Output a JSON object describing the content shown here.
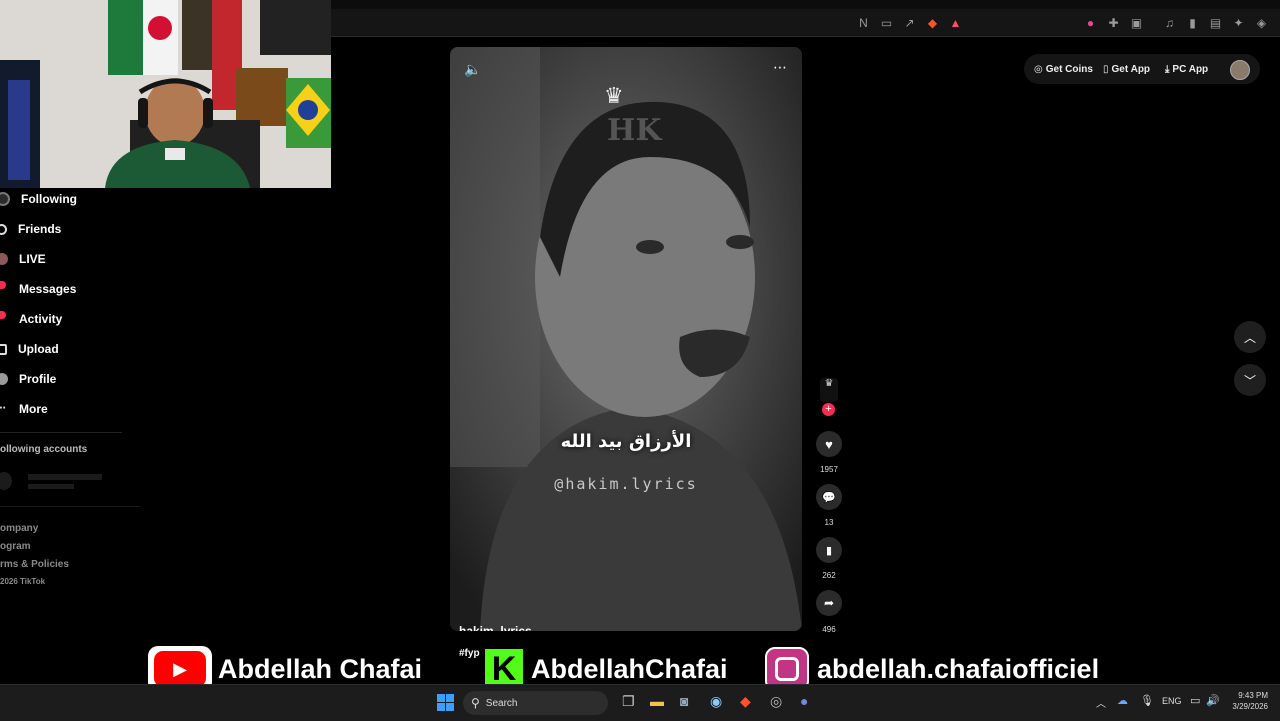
{
  "sidebar": {
    "items": [
      {
        "label": "Following",
        "icon": "following-icon"
      },
      {
        "label": "Friends",
        "icon": "friends-icon"
      },
      {
        "label": "LIVE",
        "icon": "live-icon"
      },
      {
        "label": "Messages",
        "icon": "messages-icon"
      },
      {
        "label": "Activity",
        "icon": "activity-icon"
      },
      {
        "label": "Upload",
        "icon": "upload-icon"
      },
      {
        "label": "Profile",
        "icon": "profile-icon"
      },
      {
        "label": "More",
        "icon": "more-icon"
      }
    ],
    "section_title": "ollowing accounts",
    "footer": [
      "ompany",
      "ogram",
      "rms & Policies",
      "2026 TikTok"
    ]
  },
  "header": {
    "get_coins": "Get Coins",
    "get_app": "Get App",
    "pc_app": "PC App"
  },
  "video": {
    "caption_arabic": "الأرزاق بيد الله",
    "watermark": "@hakim.lyrics",
    "author": "hakim_lyrics",
    "hashtags": "#fyp",
    "logo_text": "HK"
  },
  "actions": {
    "likes": "1957",
    "comments": "13",
    "saves": "262",
    "shares": "496"
  },
  "overlay": {
    "youtube": "Abdellah Chafai",
    "kick": "AbdellahChafai",
    "instagram": "abdellah.chafaiofficiel"
  },
  "taskbar": {
    "search_placeholder": "Search",
    "language": "ENG",
    "time": "9:43 PM",
    "date": "3/29/2026"
  },
  "colors": {
    "accent": "#fe2c55",
    "youtube_red": "#ff0000",
    "kick_green": "#53fc18"
  }
}
